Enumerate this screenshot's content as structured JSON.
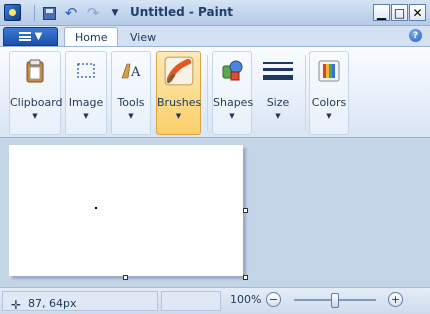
{
  "window": {
    "title": "Untitled - Paint"
  },
  "quick_access": {
    "save_icon": "save-icon",
    "undo_icon": "undo-icon",
    "redo_icon": "redo-icon",
    "more_glyph": "▼"
  },
  "tabs": [
    {
      "label": "Home",
      "active": true
    },
    {
      "label": "View",
      "active": false
    }
  ],
  "help_glyph": "?",
  "ribbon_groups": [
    {
      "label": "Clipboard",
      "icon": "clipboard-icon"
    },
    {
      "label": "Image",
      "icon": "select-icon"
    },
    {
      "label": "Tools",
      "icon": "text-tool-icon"
    },
    {
      "label": "Brushes",
      "icon": "brush-icon",
      "active": true
    },
    {
      "label": "Shapes",
      "icon": "shapes-icon"
    },
    {
      "label": "Size",
      "icon": "size-icon"
    },
    {
      "label": "Colors",
      "icon": "colors-icon"
    }
  ],
  "status": {
    "cursor_position": "87, 64px",
    "zoom_label": "100%",
    "zoom_minus": "−",
    "zoom_plus": "+",
    "zoom_level_fraction": 0.5
  },
  "colors": {
    "titlebar": "#c3d6ee",
    "ribbon_active": "#fbcf6a",
    "app_menu": "#2a62c9"
  }
}
